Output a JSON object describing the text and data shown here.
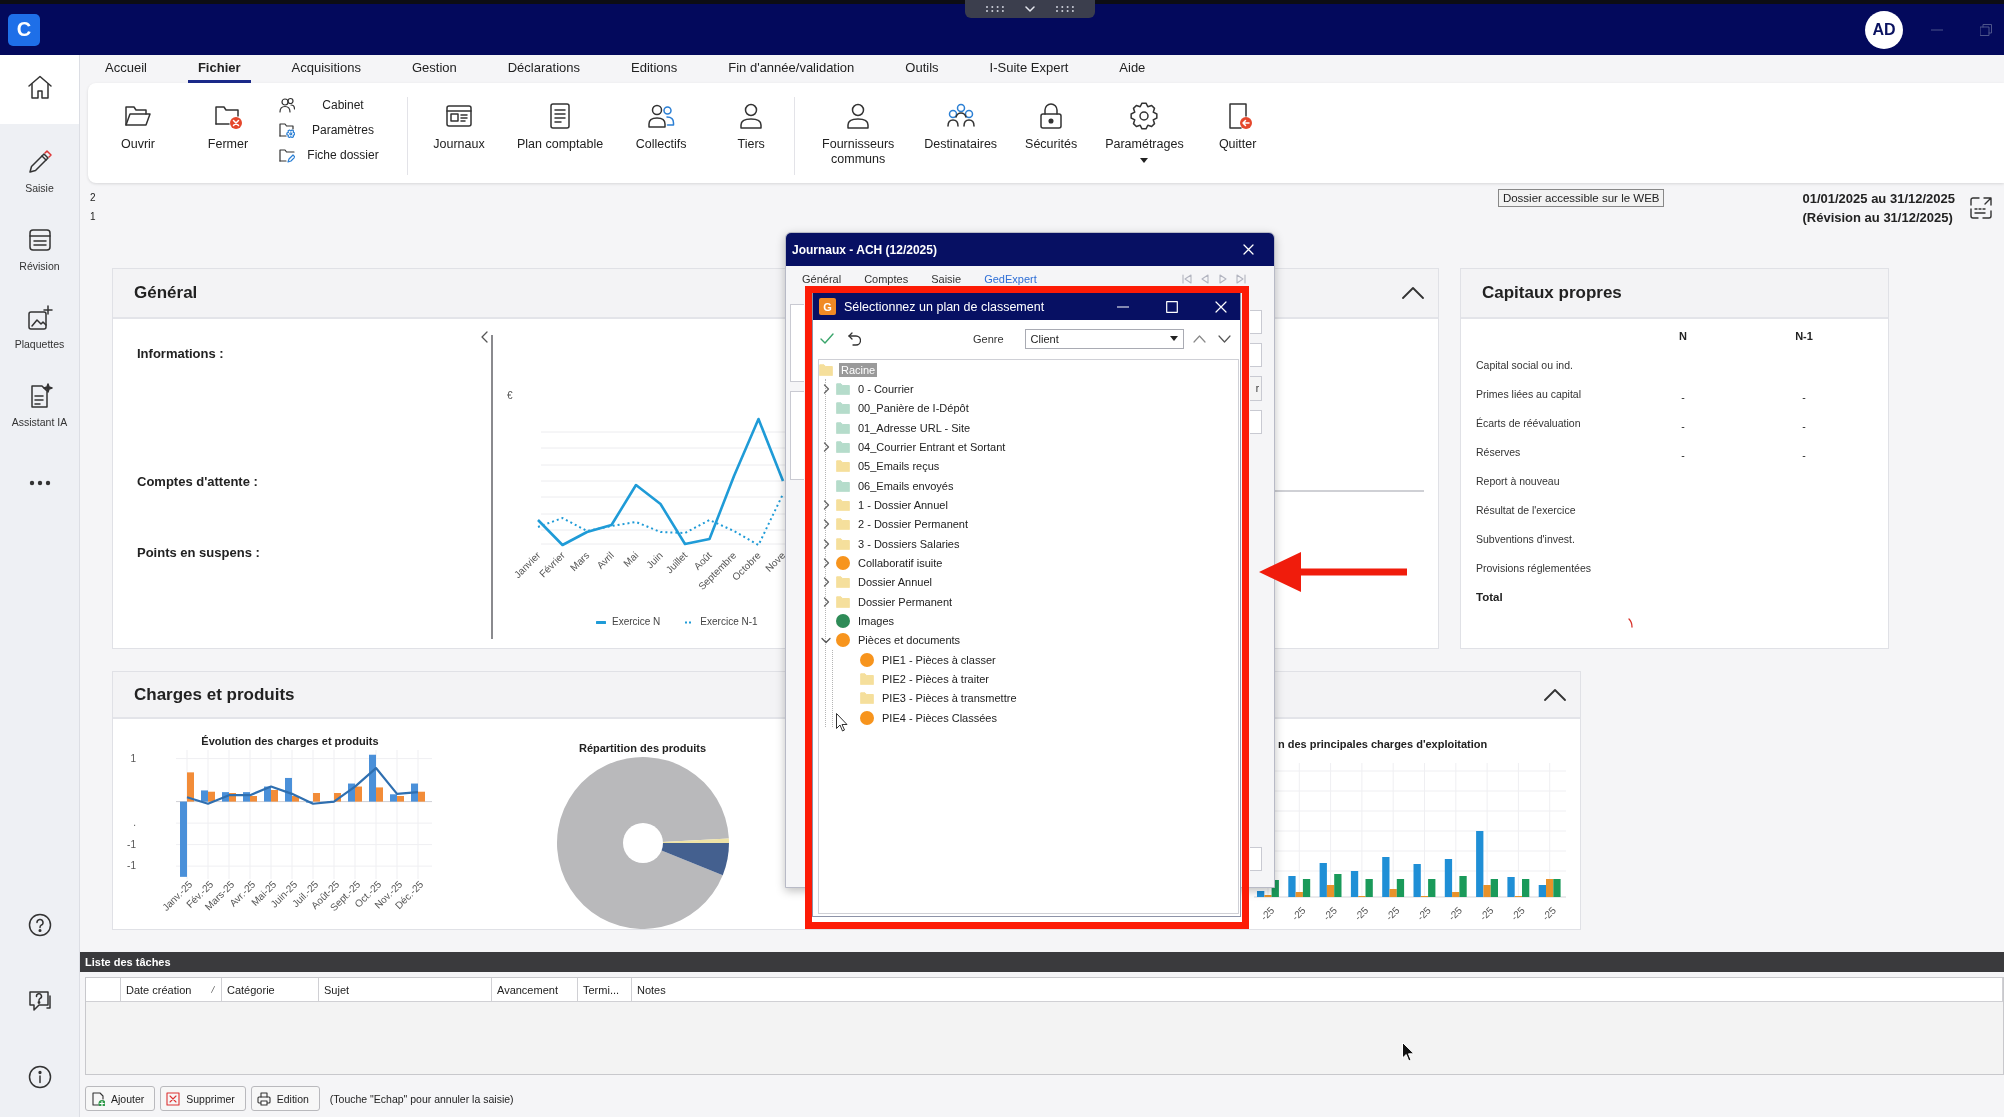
{
  "title_bar": {
    "logo": "C",
    "avatar": "AD"
  },
  "sidebar": {
    "items": [
      {
        "selected": true
      },
      {
        "label": "Saisie",
        "selected": false
      },
      {
        "label": "Révision",
        "selected": false
      },
      {
        "label": "Plaquettes",
        "selected": false
      },
      {
        "label": "Assistant IA",
        "selected": false
      }
    ]
  },
  "menu": [
    {
      "label": "Accueil",
      "selected": false
    },
    {
      "label": "Fichier",
      "selected": true
    },
    {
      "label": "Acquisitions",
      "selected": false
    },
    {
      "label": "Gestion",
      "selected": false
    },
    {
      "label": "Déclarations",
      "selected": false
    },
    {
      "label": "Editions",
      "selected": false
    },
    {
      "label": "Fin d'année/validation",
      "selected": false
    },
    {
      "label": "Outils",
      "selected": false
    },
    {
      "label": "I-Suite Expert",
      "selected": false
    },
    {
      "label": "Aide",
      "selected": false
    }
  ],
  "ribbon": {
    "groups": [
      [
        {
          "kind": "large",
          "label": "Ouvrir",
          "dropdown": false
        },
        {
          "kind": "large",
          "label": "Fermer",
          "dropdown": false
        },
        {
          "kind": "stack",
          "items": [
            "Cabinet",
            "Paramètres",
            "Fiche dossier"
          ]
        }
      ],
      [
        {
          "kind": "large",
          "label": "Journaux",
          "dropdown": false
        },
        {
          "kind": "large",
          "label": "Plan comptable",
          "dropdown": false
        },
        {
          "kind": "large",
          "label": "Collectifs",
          "dropdown": false
        },
        {
          "kind": "large",
          "label": "Tiers",
          "dropdown": false
        }
      ],
      [
        {
          "kind": "large",
          "label": "Fournisseurs communs",
          "dropdown": false
        },
        {
          "kind": "large",
          "label": "Destinataires",
          "dropdown": false
        },
        {
          "kind": "large",
          "label": "Sécurités",
          "dropdown": false
        },
        {
          "kind": "large",
          "label": "Paramétrages",
          "dropdown": true
        },
        {
          "kind": "large",
          "label": "Quitter",
          "dropdown": false
        }
      ]
    ]
  },
  "info_bar": {
    "levels": [
      "2",
      "1"
    ],
    "web_button": "Dossier accessible sur le WEB",
    "period": "01/01/2025 au 31/12/2025",
    "revision": "(Révision au 31/12/2025)"
  },
  "general_panel": {
    "title": "Général",
    "expanded": true,
    "fields": [
      "Informations :",
      "Comptes d'attente :",
      "Points en suspens :"
    ],
    "chart": {
      "unit": "€",
      "x_labels": [
        "Janvier",
        "Février",
        "Mars",
        "Avril",
        "Mai",
        "Juin",
        "Juillet",
        "Août",
        "Septembre",
        "Octobre",
        "Nove"
      ],
      "legend": [
        {
          "label": "Exercice N",
          "kind": "solid"
        },
        {
          "label": "Exercice N-1",
          "kind": "dotted"
        }
      ]
    }
  },
  "equity_panel": {
    "title": "Capitaux propres",
    "columns": [
      "N",
      "N-1"
    ],
    "rows": [
      {
        "label": "Capital social ou ind.",
        "kind": "item"
      },
      {
        "label": "Primes liées au capital",
        "kind": "item",
        "values": [
          "-",
          "-"
        ]
      },
      {
        "label": "Écarts de réévaluation",
        "kind": "item",
        "values": [
          "-",
          "-"
        ]
      },
      {
        "label": "Réserves",
        "kind": "item",
        "values": [
          "-",
          "-"
        ]
      },
      {
        "label": "Report à nouveau",
        "kind": "item"
      },
      {
        "label": "Résultat de l'exercice",
        "kind": "item"
      },
      {
        "label": "Subventions d'invest.",
        "kind": "item"
      },
      {
        "label": "Provisions réglementées",
        "kind": "item"
      },
      {
        "label": "Total",
        "kind": "total"
      }
    ]
  },
  "charges_panel": {
    "title": "Charges et produits",
    "expanded": true,
    "evolution": {
      "chart_data": {
        "type": "bar",
        "title": "Évolution des charges et produits",
        "categories": [
          "Janv.-25",
          "Fév.-25",
          "Mars-25",
          "Avr.-25",
          "Mai-25",
          "Juin-25",
          "Juil.-25",
          "Août-25",
          "Sept.-25",
          "Oct.-25",
          "Nov.-25",
          "Déc.-25"
        ],
        "series": [
          {
            "color": "#4a90d9",
            "values": [
              -1.75,
              0.26,
              0.22,
              0.22,
              0.35,
              0.55,
              0,
              0,
              0.42,
              1.09,
              0.17,
              0.42
            ]
          },
          {
            "color": "#f28c38",
            "values": [
              0.68,
              0.23,
              0.2,
              0.13,
              0.27,
              0.13,
              0.2,
              0.2,
              0.35,
              0.33,
              0.13,
              0.23
            ]
          },
          {
            "color": "#2f6fb0",
            "type": "line",
            "values": [
              0.1,
              -0.05,
              0.15,
              0.15,
              0.35,
              0.18,
              -0.05,
              0,
              0.35,
              0.78,
              0.18,
              0.22
            ]
          }
        ],
        "ylim": [
          -1.8,
          1.2
        ],
        "yticks": [
          {
            "value": 1,
            "label": "1"
          },
          {
            "value": -0.5,
            "label": "."
          },
          {
            "value": -1,
            "label": "-1"
          },
          {
            "value": -1.5,
            "label": "-1"
          }
        ],
        "grid": true
      }
    },
    "distribution": {
      "title": "Répartition des produits"
    },
    "main_charges": {
      "title": "n des principales charges d'exploitation",
      "x_labels": [
        "-25",
        "-25",
        "-25",
        "-25",
        "-25",
        "-25",
        "-25",
        "-25",
        "-25",
        "-25"
      ]
    }
  },
  "journaux_window": {
    "title": "Journaux - ACH (12/2025)",
    "tabs": [
      {
        "label": "Général",
        "selected": false
      },
      {
        "label": "Comptes",
        "selected": false
      },
      {
        "label": "Saisie",
        "selected": false
      },
      {
        "label": "GedExpert",
        "selected": true
      }
    ],
    "side_button": "r"
  },
  "classement_dialog": {
    "badge": "G",
    "title": "Sélectionnez un plan de classement",
    "genre_label": "Genre",
    "genre_value": "Client",
    "tree": [
      {
        "label": "Racine",
        "kind": "folder",
        "color": "#f5df9c",
        "selected": true,
        "expandable": false,
        "children": [
          {
            "label": "0 - Courrier",
            "kind": "folder",
            "color": "#b5dccb",
            "selected": false,
            "expandable": true,
            "expanded": false
          },
          {
            "label": "00_Panière de I-Dépôt",
            "kind": "folder",
            "color": "#b5dccb",
            "selected": false,
            "expandable": false
          },
          {
            "label": "01_Adresse URL - Site",
            "kind": "folder",
            "color": "#b5dccb",
            "selected": false,
            "expandable": false
          },
          {
            "label": "04_Courrier Entrant et Sortant",
            "kind": "folder",
            "color": "#b5dccb",
            "selected": false,
            "expandable": true,
            "expanded": false
          },
          {
            "label": "05_Emails reçus",
            "kind": "folder",
            "color": "#f5df9c",
            "selected": false,
            "expandable": false
          },
          {
            "label": "06_Emails envoyés",
            "kind": "folder",
            "color": "#b5dccb",
            "selected": false,
            "expandable": false
          },
          {
            "label": "1 - Dossier Annuel",
            "kind": "folder",
            "color": "#f5df9c",
            "selected": false,
            "expandable": true,
            "expanded": false
          },
          {
            "label": "2 - Dossier Permanent",
            "kind": "folder",
            "color": "#f5df9c",
            "selected": false,
            "expandable": true,
            "expanded": false
          },
          {
            "label": "3 - Dossiers Salaries",
            "kind": "folder",
            "color": "#f5df9c",
            "selected": false,
            "expandable": true,
            "expanded": false
          },
          {
            "label": "Collaboratif isuite",
            "kind": "dot",
            "color": "#f7941d",
            "selected": false,
            "expandable": true,
            "expanded": false
          },
          {
            "label": "Dossier Annuel",
            "kind": "folder",
            "color": "#f5df9c",
            "selected": false,
            "expandable": true,
            "expanded": false
          },
          {
            "label": "Dossier Permanent",
            "kind": "folder",
            "color": "#f5df9c",
            "selected": false,
            "expandable": true,
            "expanded": false
          },
          {
            "label": "Images",
            "kind": "dot",
            "color": "#2e8b57",
            "selected": false,
            "expandable": false
          },
          {
            "label": "Pièces et documents",
            "kind": "dot",
            "color": "#f7941d",
            "selected": false,
            "expandable": true,
            "expanded": true,
            "children": [
              {
                "label": "PIE1 - Pièces à classer",
                "kind": "dot",
                "color": "#f7941d",
                "selected": false,
                "expandable": false
              },
              {
                "label": "PIE2 - Pièces à traiter",
                "kind": "folder",
                "color": "#f5df9c",
                "selected": false,
                "expandable": false
              },
              {
                "label": "PIE3 - Pièces à transmettre",
                "kind": "folder",
                "color": "#f5df9c",
                "selected": false,
                "expandable": false
              },
              {
                "label": "PIE4 - Pièces Classées",
                "kind": "dot",
                "color": "#f7941d",
                "selected": false,
                "expandable": false
              }
            ]
          }
        ]
      }
    ]
  },
  "task_list": {
    "title": "Liste des tâches",
    "columns": [
      {
        "label": "Date création",
        "sorted": true
      },
      {
        "label": "Catégorie",
        "sorted": false
      },
      {
        "label": "Sujet",
        "sorted": false
      },
      {
        "label": "Avancement",
        "sorted": false
      },
      {
        "label": "Termi...",
        "sorted": false
      },
      {
        "label": "Notes",
        "sorted": false
      }
    ],
    "buttons": [
      "Ajouter",
      "Supprimer",
      "Edition"
    ],
    "hint": "(Touche \"Echap\" pour annuler la saisie)"
  }
}
